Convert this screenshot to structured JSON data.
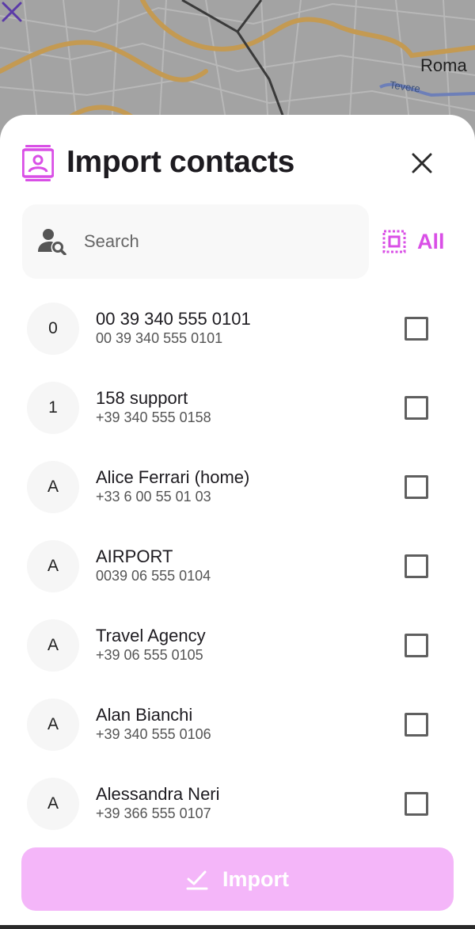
{
  "map": {
    "city_label": "Roma",
    "river_label": "Tevere"
  },
  "sheet": {
    "title": "Import contacts",
    "search": {
      "placeholder": "Search",
      "value": ""
    },
    "select_all_label": "All",
    "contacts": [
      {
        "initial": "0",
        "name": "00 39 340 555 0101",
        "phone": "00 39 340 555 0101",
        "checked": false
      },
      {
        "initial": "1",
        "name": "158 support",
        "phone": "+39 340 555 0158",
        "checked": false
      },
      {
        "initial": "A",
        "name": "Alice Ferrari (home)",
        "phone": "+33 6 00 55 01 03",
        "checked": false
      },
      {
        "initial": "A",
        "name": "AIRPORT",
        "phone": "0039 06 555 0104",
        "checked": false
      },
      {
        "initial": "A",
        "name": "Travel Agency",
        "phone": "+39 06 555 0105",
        "checked": false
      },
      {
        "initial": "A",
        "name": "Alan Bianchi",
        "phone": "+39 340 555 0106",
        "checked": false
      },
      {
        "initial": "A",
        "name": "Alessandra Neri",
        "phone": "+39 366 555 0107",
        "checked": false
      }
    ],
    "import_label": "Import"
  },
  "colors": {
    "accent": "#d94fe6",
    "import_button": "#f4b6f9",
    "title": "#1d1b20"
  },
  "icons": [
    "map-close-icon",
    "contact-book-icon",
    "close-icon",
    "person-search-icon",
    "select-all-icon",
    "checkmark-icon"
  ]
}
